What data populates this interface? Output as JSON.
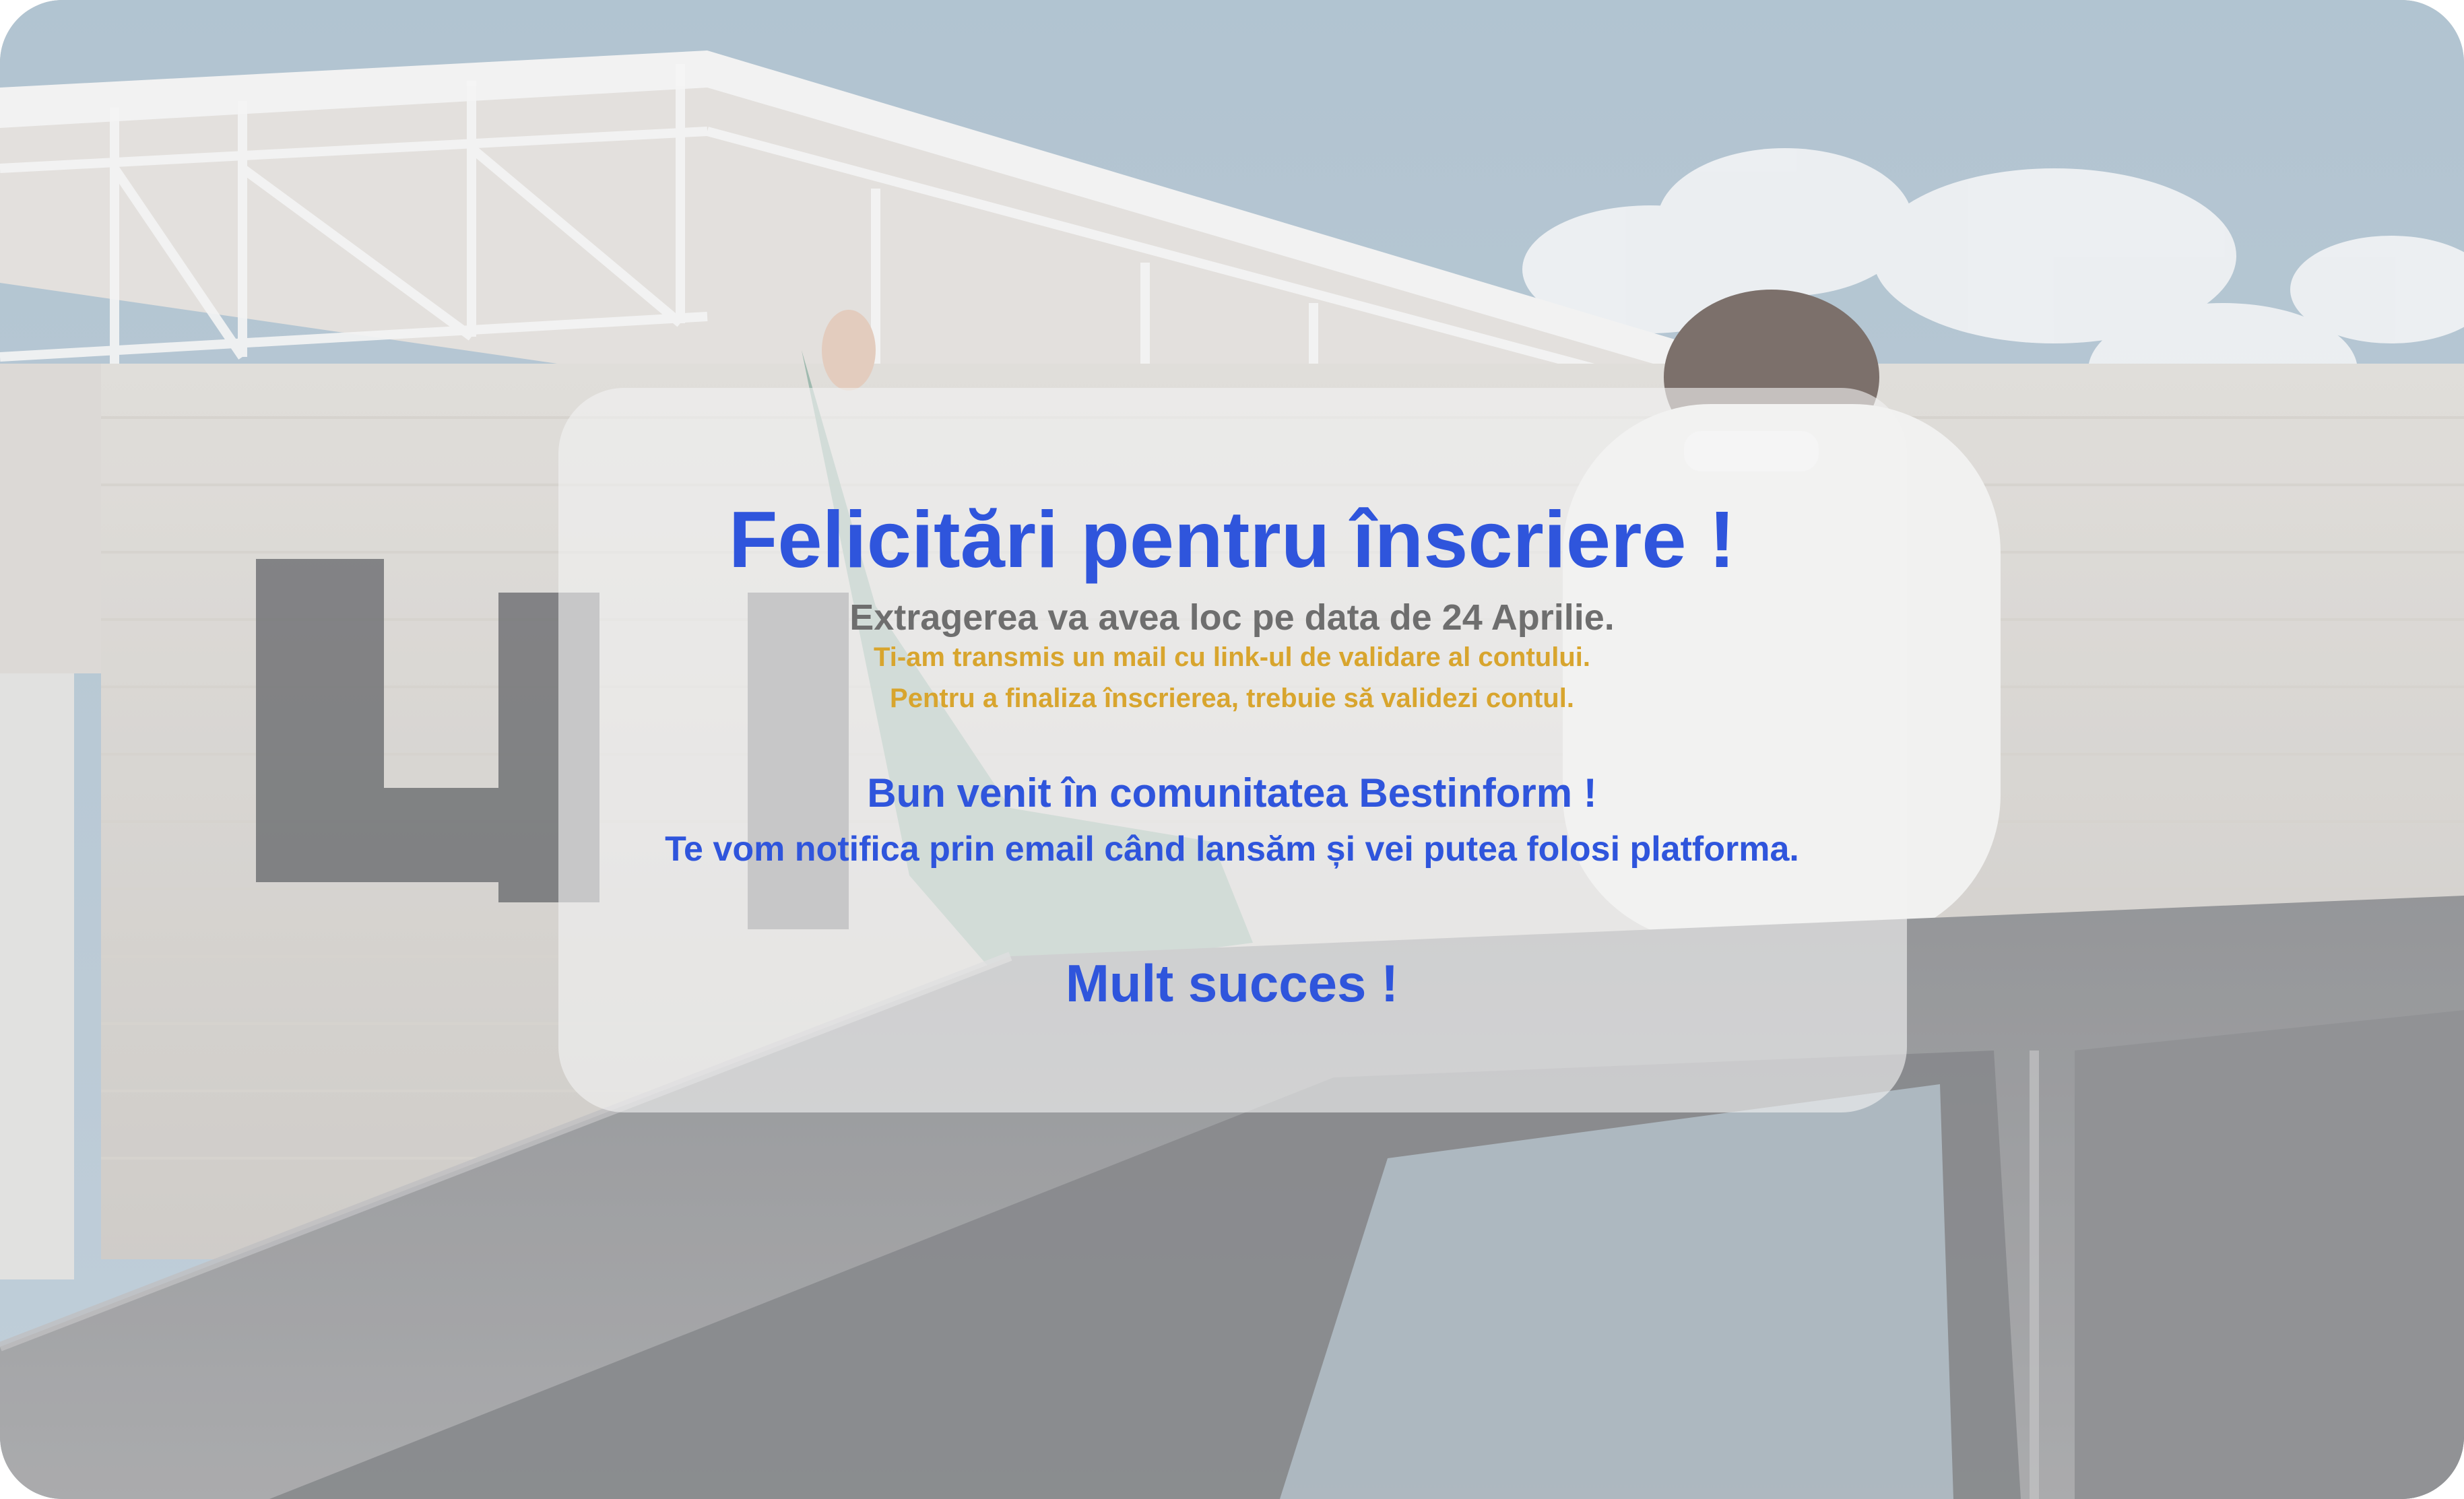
{
  "colors": {
    "accent_blue": "#2f55dc",
    "info_gray": "#6e6e6e",
    "warning_gold": "#d8a52e",
    "card_background": "#f2f2f2"
  },
  "background": {
    "image_description_icon": "photo-background-icon"
  },
  "confirmation": {
    "title": "Felicitări pentru înscriere !",
    "draw_date": "Extragerea va avea loc pe data de 24 Aprilie.",
    "mail_sent": "Ti-am transmis un mail cu link-ul de validare al contului.",
    "validate_instruction": "Pentru a finaliza înscrierea, trebuie să validezi contul.",
    "welcome": "Bun venit în comunitatea Bestinform !",
    "notify": "Te vom notifica prin email când lansăm și vei putea folosi platforma.",
    "success": "Mult succes !"
  }
}
